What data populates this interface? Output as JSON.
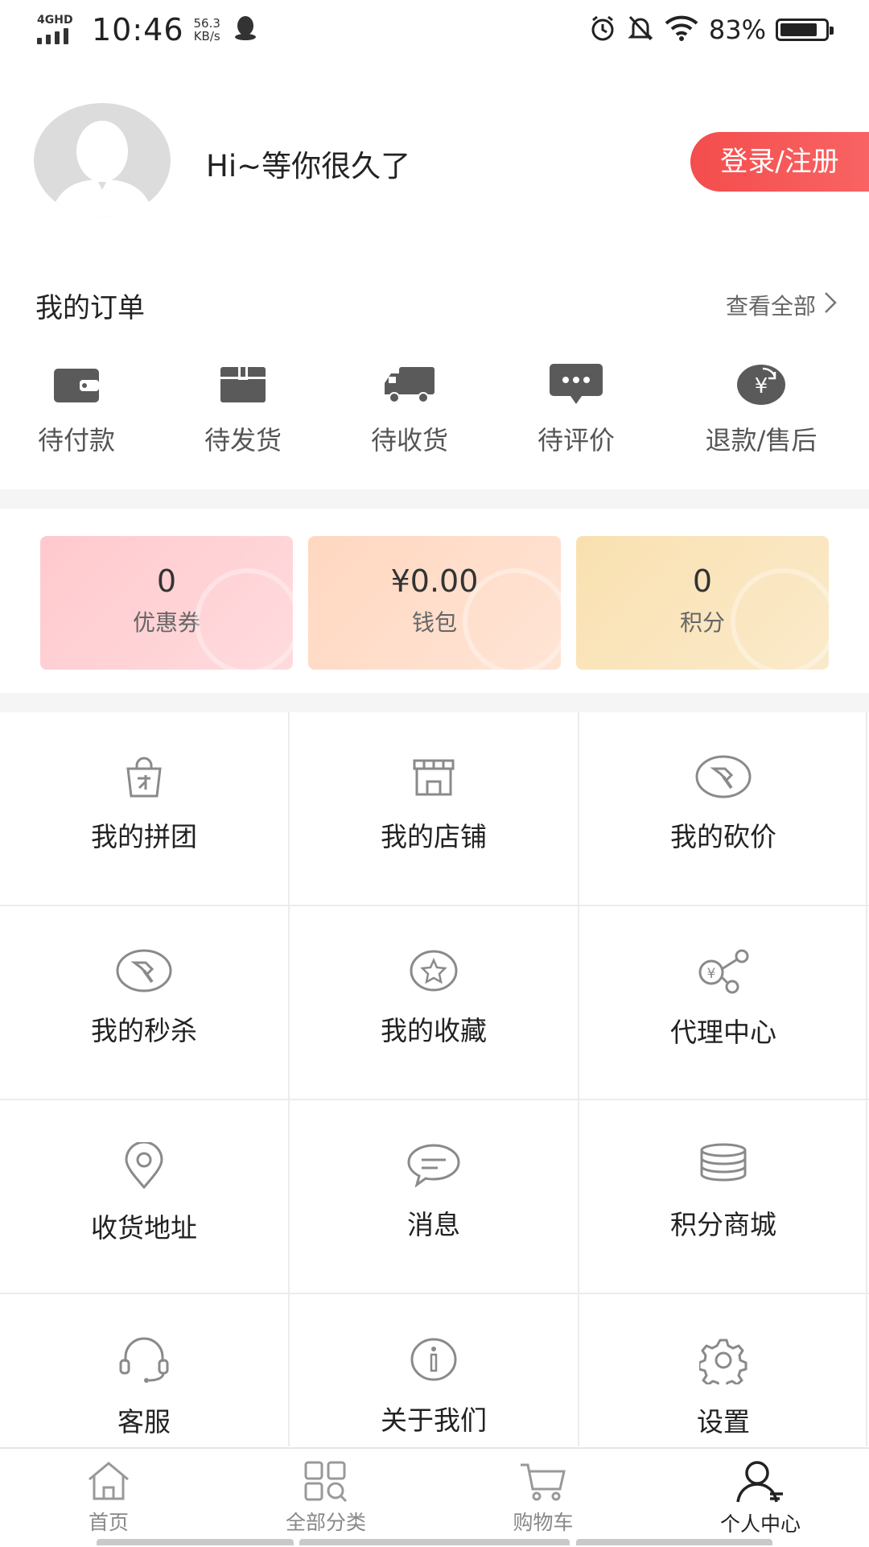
{
  "status_bar": {
    "network": "4GHD",
    "time": "10:46",
    "speed_value": "56.3",
    "speed_unit": "KB/s",
    "battery_percent": "83%",
    "battery_level": 0.83,
    "icons": [
      "qq-icon",
      "alarm-icon",
      "bell-off-icon",
      "wifi-icon",
      "battery-icon"
    ]
  },
  "profile": {
    "greeting": "Hi~等你很久了",
    "login_label": "登录/注册"
  },
  "orders": {
    "title": "我的订单",
    "view_all": "查看全部",
    "items": [
      {
        "label": "待付款",
        "icon": "wallet-icon"
      },
      {
        "label": "待发货",
        "icon": "package-icon"
      },
      {
        "label": "待收货",
        "icon": "truck-icon"
      },
      {
        "label": "待评价",
        "icon": "comment-icon"
      },
      {
        "label": "退款/售后",
        "icon": "refund-icon"
      }
    ]
  },
  "assets": [
    {
      "value": "0",
      "label": "优惠券",
      "color": "#ffc9cd"
    },
    {
      "value": "¥0.00",
      "label": "钱包",
      "color": "#ffd7c0"
    },
    {
      "value": "0",
      "label": "积分",
      "color": "#f9e0b0"
    }
  ],
  "menu": [
    {
      "label": "我的拼团",
      "icon": "group-bag-icon"
    },
    {
      "label": "我的店铺",
      "icon": "store-icon"
    },
    {
      "label": "我的砍价",
      "icon": "bargain-icon"
    },
    {
      "label": "我的秒杀",
      "icon": "flash-sale-icon"
    },
    {
      "label": "我的收藏",
      "icon": "favorite-star-icon"
    },
    {
      "label": "代理中心",
      "icon": "agent-share-icon"
    },
    {
      "label": "收货地址",
      "icon": "location-pin-icon"
    },
    {
      "label": "消息",
      "icon": "message-icon"
    },
    {
      "label": "积分商城",
      "icon": "coins-stack-icon"
    },
    {
      "label": "客服",
      "icon": "headset-icon"
    },
    {
      "label": "关于我们",
      "icon": "info-icon"
    },
    {
      "label": "设置",
      "icon": "gear-icon"
    }
  ],
  "tabbar": [
    {
      "label": "首页",
      "icon": "home-icon",
      "active": false
    },
    {
      "label": "全部分类",
      "icon": "category-icon",
      "active": false
    },
    {
      "label": "购物车",
      "icon": "cart-icon",
      "active": false
    },
    {
      "label": "个人中心",
      "icon": "user-icon",
      "active": true
    }
  ],
  "colors": {
    "accent": "#f44d4d",
    "icon_gray": "#5a5a5a",
    "text_dark": "#222222"
  }
}
